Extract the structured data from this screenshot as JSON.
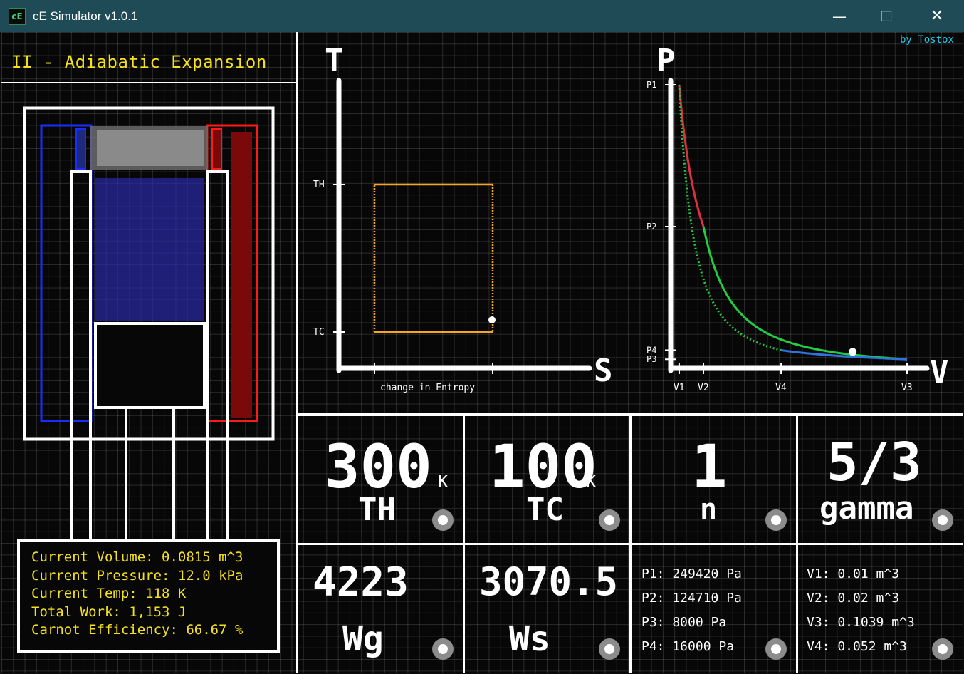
{
  "window": {
    "title": "cE Simulator v1.0.1",
    "icon_text": "cE",
    "minimize": "—",
    "maximize": "☐",
    "close": "✕"
  },
  "credit": "by Tostox",
  "mode_title": "II - Adiabatic Expansion",
  "info": {
    "volume": "Current Volume: 0.0815  m^3",
    "pressure": "Current Pressure: 12.0 kPa",
    "temp": "Current Temp: 118 K",
    "work": "Total Work: 1,153 J",
    "efficiency": "Carnot Efficiency: 66.67 %"
  },
  "ts_chart": {
    "t_label": "T",
    "s_label": "S",
    "th_tick": "TH",
    "tc_tick": "TC",
    "x_caption": "change in Entropy",
    "color": "#f5a623"
  },
  "pv_chart": {
    "p_label": "P",
    "v_label": "V",
    "p_ticks": [
      "P1",
      "P2",
      "P4",
      "P3"
    ],
    "v_ticks": [
      "V1",
      "V2",
      "V4",
      "V3"
    ],
    "colors": {
      "isothermal_hot": "#e03040",
      "adiabatic": "#22cc44",
      "isothermal_cold": "#2e74e0",
      "marker": "#ffffff"
    }
  },
  "controls": {
    "th": {
      "value": "300",
      "unit": "K",
      "label": "TH"
    },
    "tc": {
      "value": "100",
      "unit": "K",
      "label": "TC"
    },
    "n": {
      "value": "1",
      "label": "n"
    },
    "gamma": {
      "value": "5/3",
      "label": "gamma"
    },
    "wg": {
      "value": "4223",
      "label": "Wg"
    },
    "ws": {
      "value": "3070.5",
      "label": "Ws"
    },
    "pressures": [
      "P1: 249420 Pa",
      "P2: 124710 Pa",
      "P3: 8000 Pa",
      "P4: 16000 Pa"
    ],
    "volumes": [
      "V1: 0.01 m^3",
      "V2: 0.02 m^3",
      "V3: 0.1039 m^3",
      "V4: 0.052 m^3"
    ]
  },
  "chart_data": [
    {
      "type": "line",
      "title": "",
      "xlabel": "S",
      "ylabel": "T",
      "x_caption": "change in Entropy",
      "y_ticks": [
        "TH",
        "TC"
      ],
      "series": [
        {
          "points": [
            [
              0,
              300
            ],
            [
              1,
              300
            ],
            [
              1,
              100
            ],
            [
              0,
              100
            ],
            [
              0,
              300
            ]
          ]
        }
      ],
      "current_point": [
        1,
        118
      ],
      "grid": true
    },
    {
      "type": "line",
      "title": "",
      "xlabel": "V",
      "ylabel": "P",
      "x_ticks": [
        "V1",
        "V2",
        "V4",
        "V3"
      ],
      "y_ticks": [
        "P1",
        "P2",
        "P4",
        "P3"
      ],
      "series": [
        {
          "color": "#e03040",
          "x": [
            0.01,
            0.02
          ],
          "y": [
            249420,
            124710
          ]
        },
        {
          "color": "#22cc44",
          "x": [
            0.02,
            0.1039
          ],
          "y": [
            124710,
            8000
          ]
        },
        {
          "color": "#2e74e0",
          "x": [
            0.1039,
            0.052
          ],
          "y": [
            8000,
            16000
          ]
        },
        {
          "color": "#22cc44",
          "x": [
            0.052,
            0.01
          ],
          "y": [
            16000,
            249420
          ]
        }
      ],
      "current_point": [
        0.0815,
        12000
      ],
      "grid": true
    }
  ]
}
